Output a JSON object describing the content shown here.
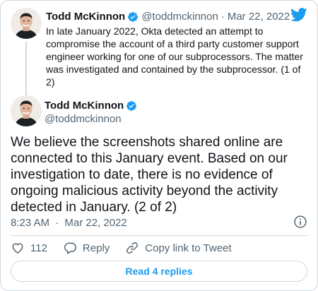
{
  "parent_tweet": {
    "author_name": "Todd McKinnon",
    "handle": "@toddmckinnon",
    "separator": "·",
    "date": "Mar 22, 2022",
    "text": "In late January 2022, Okta detected an attempt to compromise the account of a third party customer support engineer working for one of our subprocessors. The matter was investigated and contained by the subprocessor. (1 of 2)"
  },
  "main_tweet": {
    "author_name": "Todd McKinnon",
    "handle": "@toddmckinnon",
    "text": "We believe the screenshots shared online are connected to this January event. Based on our investigation to date, there is no evidence of ongoing malicious activity beyond the activity detected in January. (2 of 2)",
    "time": "8:23 AM",
    "separator": "·",
    "date": "Mar 22, 2022"
  },
  "actions": {
    "like_count": "112",
    "reply_label": "Reply",
    "copy_link_label": "Copy link to Tweet"
  },
  "read_replies_label": "Read 4 replies",
  "colors": {
    "accent": "#1d9bf0",
    "muted": "#536471",
    "border": "#cfd9de",
    "like_icon": "#536471"
  },
  "icons": [
    "twitter-bird-icon",
    "verified-badge-icon",
    "info-icon",
    "heart-icon",
    "reply-icon",
    "link-icon"
  ]
}
